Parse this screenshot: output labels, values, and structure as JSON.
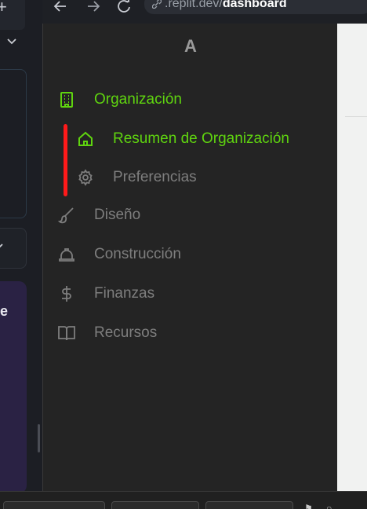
{
  "browser": {
    "url_prefix": ".replit.dev/",
    "url_path": "dashboard"
  },
  "left_panel": {
    "purple_letter": "e"
  },
  "sidebar": {
    "brand": "A",
    "items": [
      {
        "label": "Organización",
        "icon": "building-icon",
        "state": "active"
      },
      {
        "label": "Resumen de Organización",
        "icon": "home-icon",
        "state": "active-sub"
      },
      {
        "label": "Preferencias",
        "icon": "gear-icon",
        "state": "sub"
      },
      {
        "label": "Diseño",
        "icon": "brush-icon",
        "state": "normal"
      },
      {
        "label": "Construcción",
        "icon": "hard-hat-icon",
        "state": "normal"
      },
      {
        "label": "Finanzas",
        "icon": "dollar-icon",
        "state": "normal"
      },
      {
        "label": "Recursos",
        "icon": "book-icon",
        "state": "normal"
      }
    ]
  },
  "colors": {
    "active": "#5fd40f",
    "inactive": "#7e7e7e",
    "highlight_bar": "#ff1a1a",
    "sidebar_bg": "#242424"
  }
}
